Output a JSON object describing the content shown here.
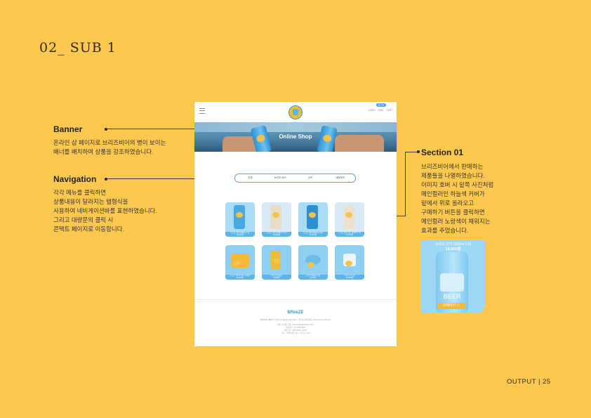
{
  "page": {
    "title": "02_ SUB 1",
    "footer": "OUTPUT  |  25"
  },
  "annotations": {
    "banner": {
      "heading": "Banner",
      "text": "온라인 샵 페이지로 브리즈비어의 병이 보이는\n배너를 배치하여 상품을 강조하였습니다."
    },
    "navigation": {
      "heading": "Navigation",
      "text": "각각 메뉴를 클릭하면\n상품내용이 달라지는 탭형식을\n사용하여 네비게이션바를 표현하였습니다.\n그리고 대량문의 클릭 시\n콘택트 페이지로 이동합니다."
    },
    "section01": {
      "heading": "Section 01",
      "text": "브리즈비어에서 판매하는\n제품들을 나열하였습니다.\n이미지 호버 시 밑쪽 사진처럼\n메인컬러인 하늘색 커버가\n밑에서 위로 올라오고\n구매하기 버튼을 클릭하면\n메인컬러 노랑색이 채워지는\n효과를 주었습니다."
    }
  },
  "mockup": {
    "header": {
      "login_chip": "로그인",
      "util_links": [
        "LOGIN",
        "JOIN",
        "CART"
      ]
    },
    "banner_title": "Online Shop",
    "tabs": [
      "전체",
      "브리즈 비어",
      "굿즈",
      "대량문의"
    ],
    "products": [
      {
        "caption": "브리즈 비어 (355ml x 6)",
        "price": "18,000원"
      },
      {
        "caption": "브리즈 비어 (355ml x 12)",
        "price": "34,000원"
      },
      {
        "caption": "브리즈 비어 (355ml x 24)",
        "price": "66,000원"
      },
      {
        "caption": "브리즈 비어 세트 (355ml x 4)",
        "price": "14,000원"
      },
      {
        "caption": "브리즈 맥주잔 세트 (2개입)",
        "price": "25,000원"
      },
      {
        "caption": "브리즈 캔 홀더",
        "price": "8,000원"
      },
      {
        "caption": "브리즈 병따개 키링",
        "price": "6,000원"
      },
      {
        "caption": "브리즈 머그컵",
        "price": "12,000원"
      }
    ],
    "footer": {
      "logo": "BReeZE",
      "lines": [
        "BREEZE BEER © 2021. All Rights Reserved.  |  개인정보처리방침  |  Terms and Conditions",
        "제휴 및 대량 구매 : Partnership@breeze.co.kr",
        "대표번호 : 02-1234-5678",
        "운영시간 : 평일 09:00 - 18:00",
        "주소 : 서울특별시 중구 브리즈로 123"
      ]
    }
  },
  "section_card": {
    "title": "브리즈 비어 (355ml x 6)",
    "price": "18,000원",
    "can_label": "BEER",
    "button": "구매하기 ▷"
  },
  "colors": {
    "background": "#fdc84f",
    "accent_blue": "#4fa8e6",
    "accent_yellow": "#f3b93a"
  }
}
